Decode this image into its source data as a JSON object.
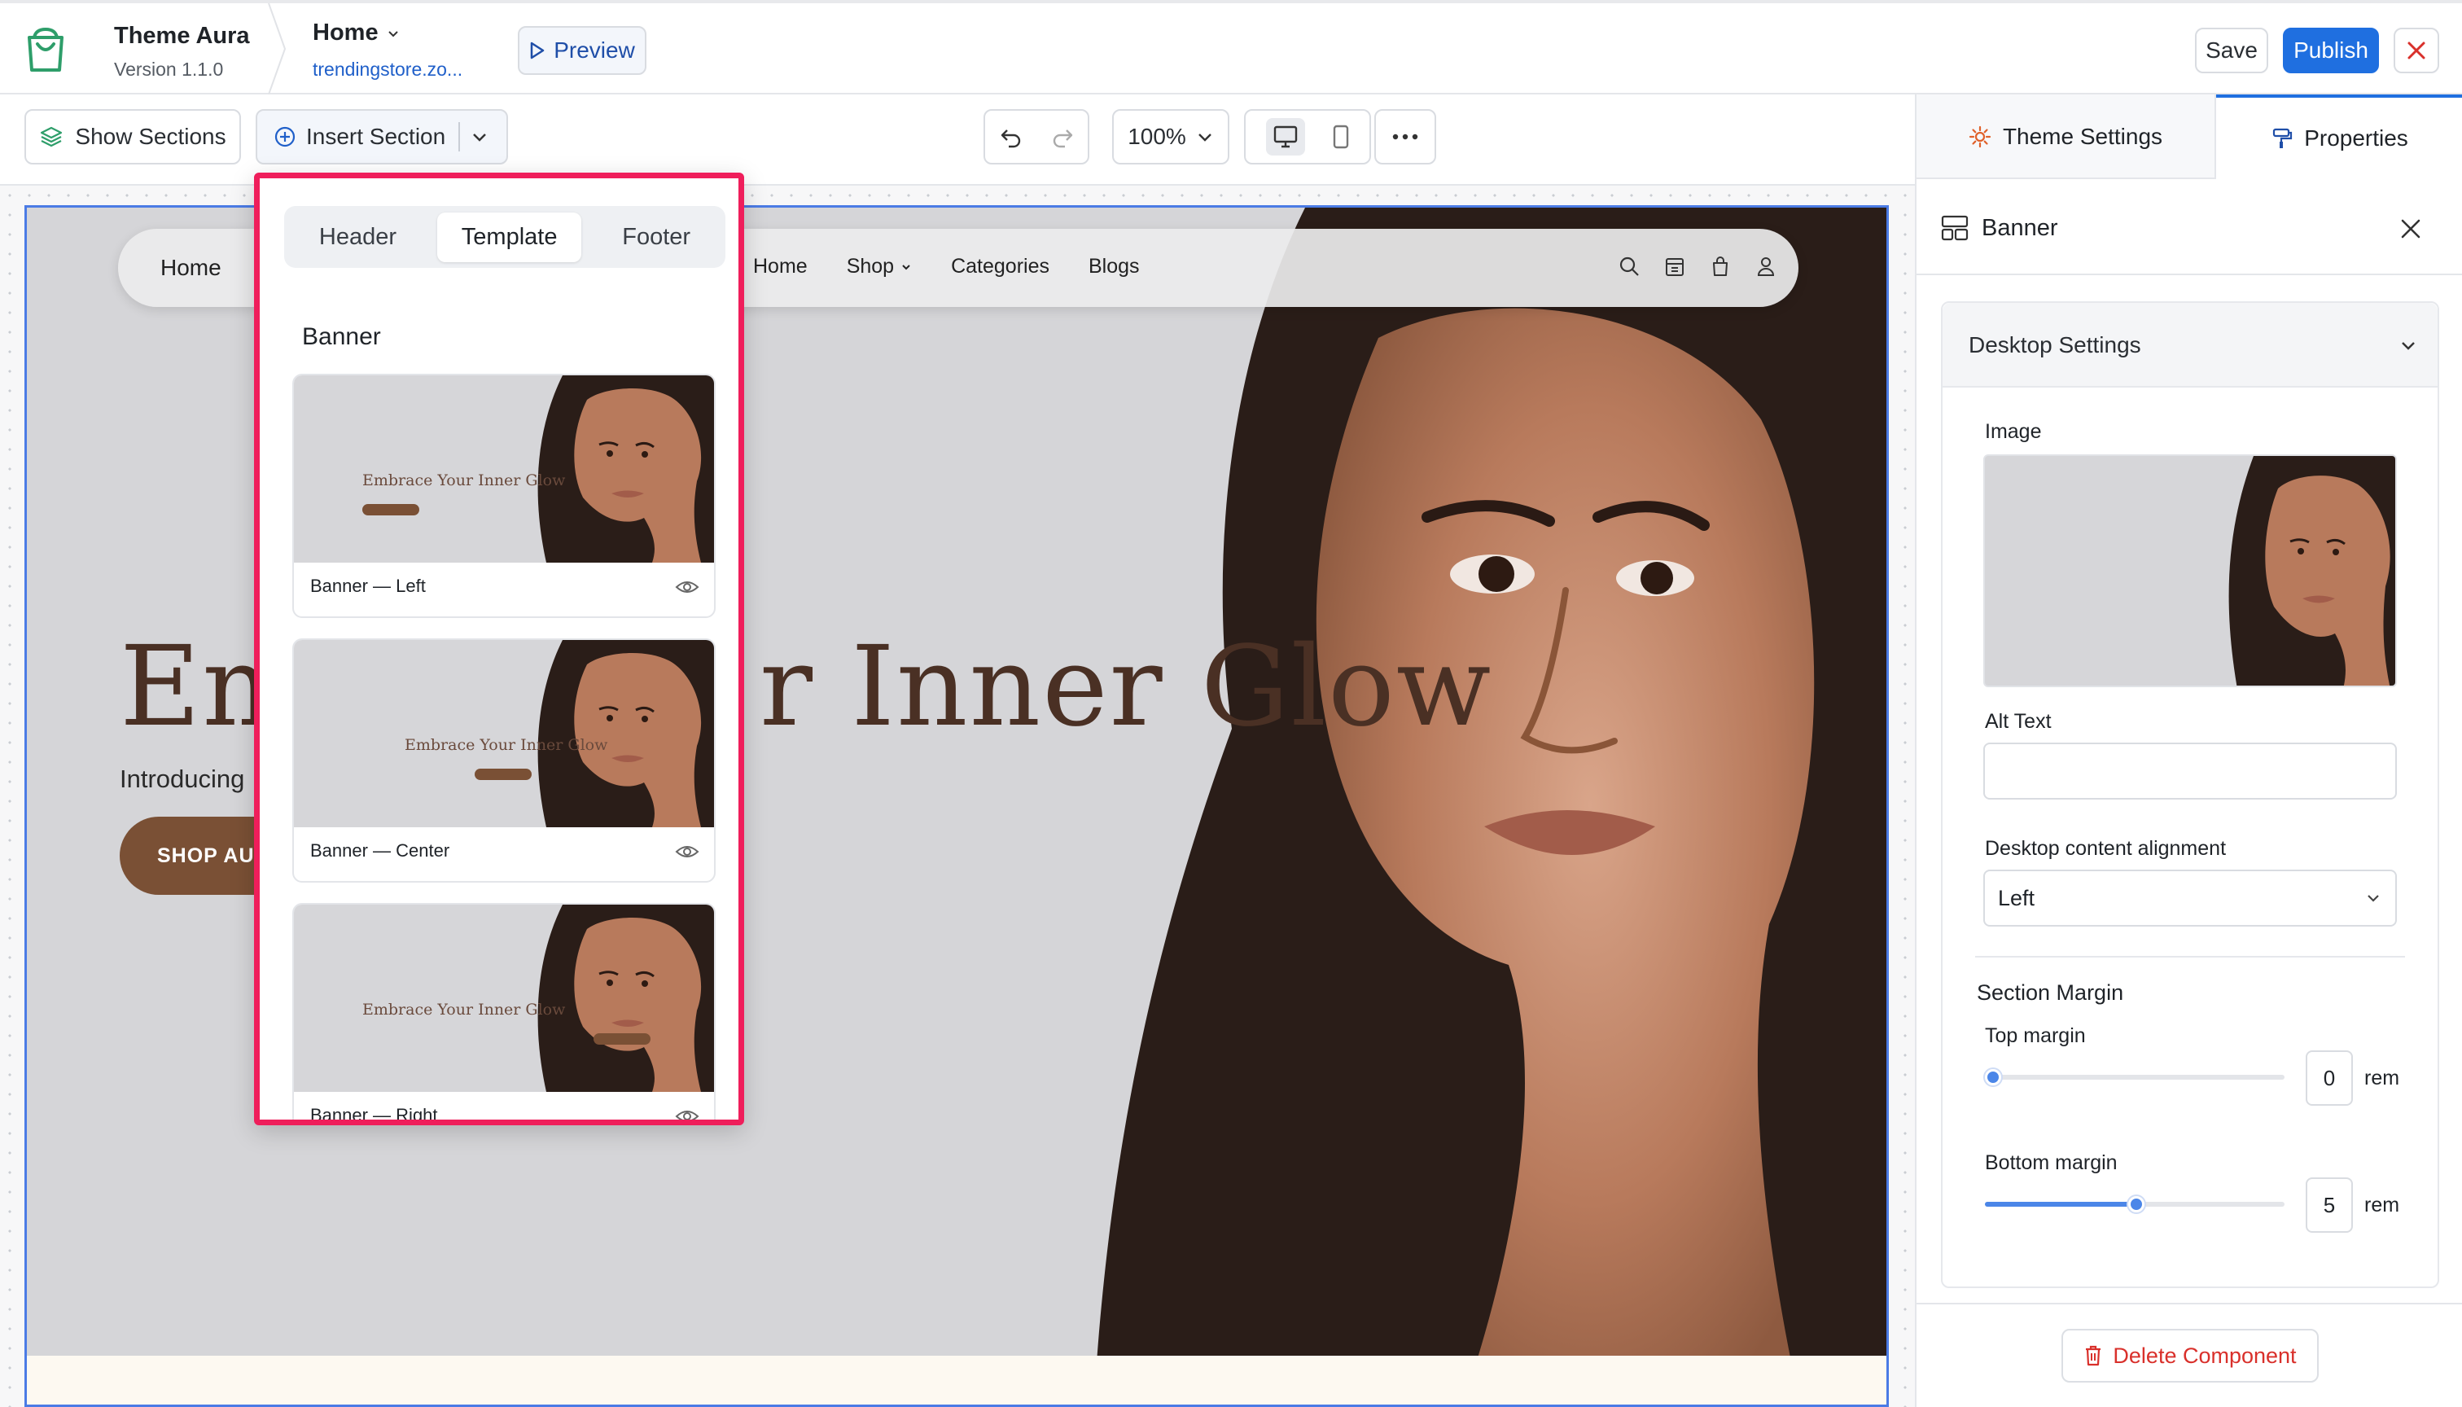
{
  "header": {
    "app_name": "Theme Aura",
    "version": "Version 1.1.0",
    "page_name": "Home",
    "store_url": "trendingstore.zo...",
    "preview_label": "Preview",
    "save_label": "Save",
    "publish_label": "Publish"
  },
  "toolbar": {
    "show_sections_label": "Show Sections",
    "insert_section_label": "Insert Section",
    "zoom": "100%"
  },
  "popover": {
    "tabs": [
      {
        "label": "Header",
        "active": false
      },
      {
        "label": "Template",
        "active": true
      },
      {
        "label": "Footer",
        "active": false
      }
    ],
    "section_title": "Banner",
    "cards": [
      {
        "label": "Banner — Left",
        "thumb_text": "Embrace Your Inner Glow"
      },
      {
        "label": "Banner — Center",
        "thumb_text": "Embrace Your Inner Glow"
      },
      {
        "label": "Banner — Right",
        "thumb_text": "Embrace Your Inner Glow"
      }
    ]
  },
  "site": {
    "nav_home_left": "Home",
    "nav": [
      "Home",
      "Shop",
      "Categories",
      "Blogs"
    ],
    "headline_start": "Em",
    "headline_end": "r Inner Glow",
    "intro_partial": "Introducing",
    "cta_partial": "SHOP AU"
  },
  "panel": {
    "tabs": [
      {
        "label": "Theme Settings",
        "active": false
      },
      {
        "label": "Properties",
        "active": true
      }
    ],
    "component_title": "Banner",
    "group_title": "Desktop Settings",
    "image_label": "Image",
    "alt_text_label": "Alt Text",
    "alt_text_value": "",
    "alignment_label": "Desktop content alignment",
    "alignment_value": "Left",
    "margin_section_title": "Section Margin",
    "top_margin_label": "Top margin",
    "top_margin_value": "0",
    "bottom_margin_label": "Bottom margin",
    "bottom_margin_value": "5",
    "unit": "rem",
    "delete_label": "Delete Component"
  },
  "colors": {
    "publish_blue": "#1f6fe0",
    "selection_pink": "#ef1e5b",
    "headline_brown": "#4a3024",
    "cta_brown": "#7a5035",
    "delete_red": "#d9302b",
    "slider_blue": "#4b86e8"
  }
}
